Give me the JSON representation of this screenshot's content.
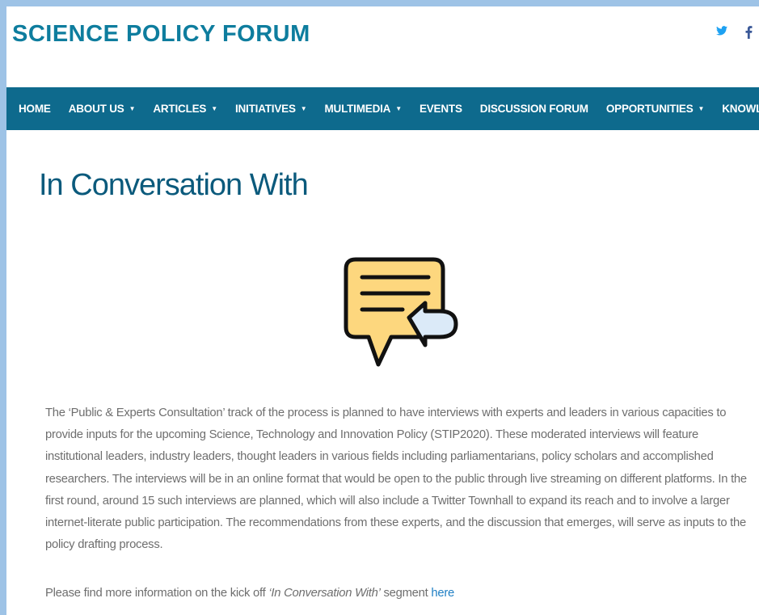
{
  "header": {
    "logo_text": "SCIENCE POLICY FORUM",
    "social": [
      {
        "name": "twitter-icon"
      },
      {
        "name": "facebook-icon"
      }
    ]
  },
  "nav": {
    "items": [
      {
        "label": "HOME",
        "dropdown": false
      },
      {
        "label": "ABOUT US",
        "dropdown": true
      },
      {
        "label": "ARTICLES",
        "dropdown": true
      },
      {
        "label": "INITIATIVES",
        "dropdown": true
      },
      {
        "label": "MULTIMEDIA",
        "dropdown": true
      },
      {
        "label": "EVENTS",
        "dropdown": false
      },
      {
        "label": "DISCUSSION FORUM",
        "dropdown": false
      },
      {
        "label": "OPPORTUNITIES",
        "dropdown": true
      },
      {
        "label": "KNOWLEDGE CE",
        "dropdown": false
      }
    ],
    "caret_glyph": "▼"
  },
  "main": {
    "title": "In Conversation With",
    "body": "The ‘Public & Experts Consultation’ track of the process is planned to have interviews with experts and leaders in various capacities to provide inputs for the upcoming Science, Technology and Innovation Policy (STIP2020). These moderated interviews will feature institutional leaders, industry leaders, thought leaders in various fields including parliamentarians, policy scholars and accomplished researchers. The interviews will be in an online format that would be open to the public through live streaming on different platforms. In the first round, around 15 such interviews are planned, which will also include a Twitter Townhall to expand its reach and to involve a larger internet-literate public participation. The recommendations from these experts, and the discussion that emerges, will serve as inputs to the policy drafting process.",
    "more_prefix": "Please find more information on the kick off ",
    "more_italic": "‘In Conversation With’",
    "more_suffix": " segment ",
    "more_link": "here"
  },
  "colors": {
    "nav_bg": "#0e6a8d",
    "logo": "#0e7d9e",
    "title": "#0b5a7c",
    "link": "#1f7fc4",
    "twitter": "#1da1f2",
    "facebook": "#3b5998"
  }
}
